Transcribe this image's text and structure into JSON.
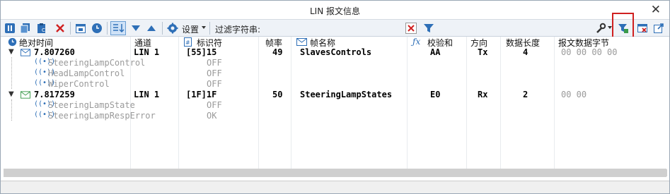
{
  "window": {
    "title": "LIN 报文信息"
  },
  "toolbar": {
    "settings_label": "设置",
    "filter_label": "过滤字符串:",
    "filter_value": ""
  },
  "columns": {
    "time": "绝对时间",
    "channel": "通道",
    "id": "标识符",
    "freq": "帧率",
    "name": "帧名称",
    "checksum": "校验和",
    "dir": "方向",
    "dlc": "数据长度",
    "data": "报文数据字节"
  },
  "frames": [
    {
      "time": "7.807260",
      "channel": "LIN 1",
      "id": "[55]15",
      "freq": "49",
      "name": "SlavesControls",
      "checksum": "AA",
      "dir": "Tx",
      "dlc": "4",
      "data": "00 00 00 00",
      "signals": [
        {
          "name": "SteeringLampControl",
          "value": "OFF"
        },
        {
          "name": "HeadLampControl",
          "value": "OFF"
        },
        {
          "name": "WiperControl",
          "value": "OFF"
        }
      ]
    },
    {
      "time": "7.817259",
      "channel": "LIN 1",
      "id": "[1F]1F",
      "freq": "50",
      "name": "SteeringLampStates",
      "checksum": "E0",
      "dir": "Rx",
      "dlc": "2",
      "data": "00 00",
      "signals": [
        {
          "name": "SteeringLampState",
          "value": "OFF"
        },
        {
          "name": "SteeringLampRespError",
          "value": "OK"
        }
      ]
    }
  ],
  "colors": {
    "accent": "#2e6fb7",
    "highlight": "#d02020",
    "signal_text": "#9a9a9a"
  }
}
